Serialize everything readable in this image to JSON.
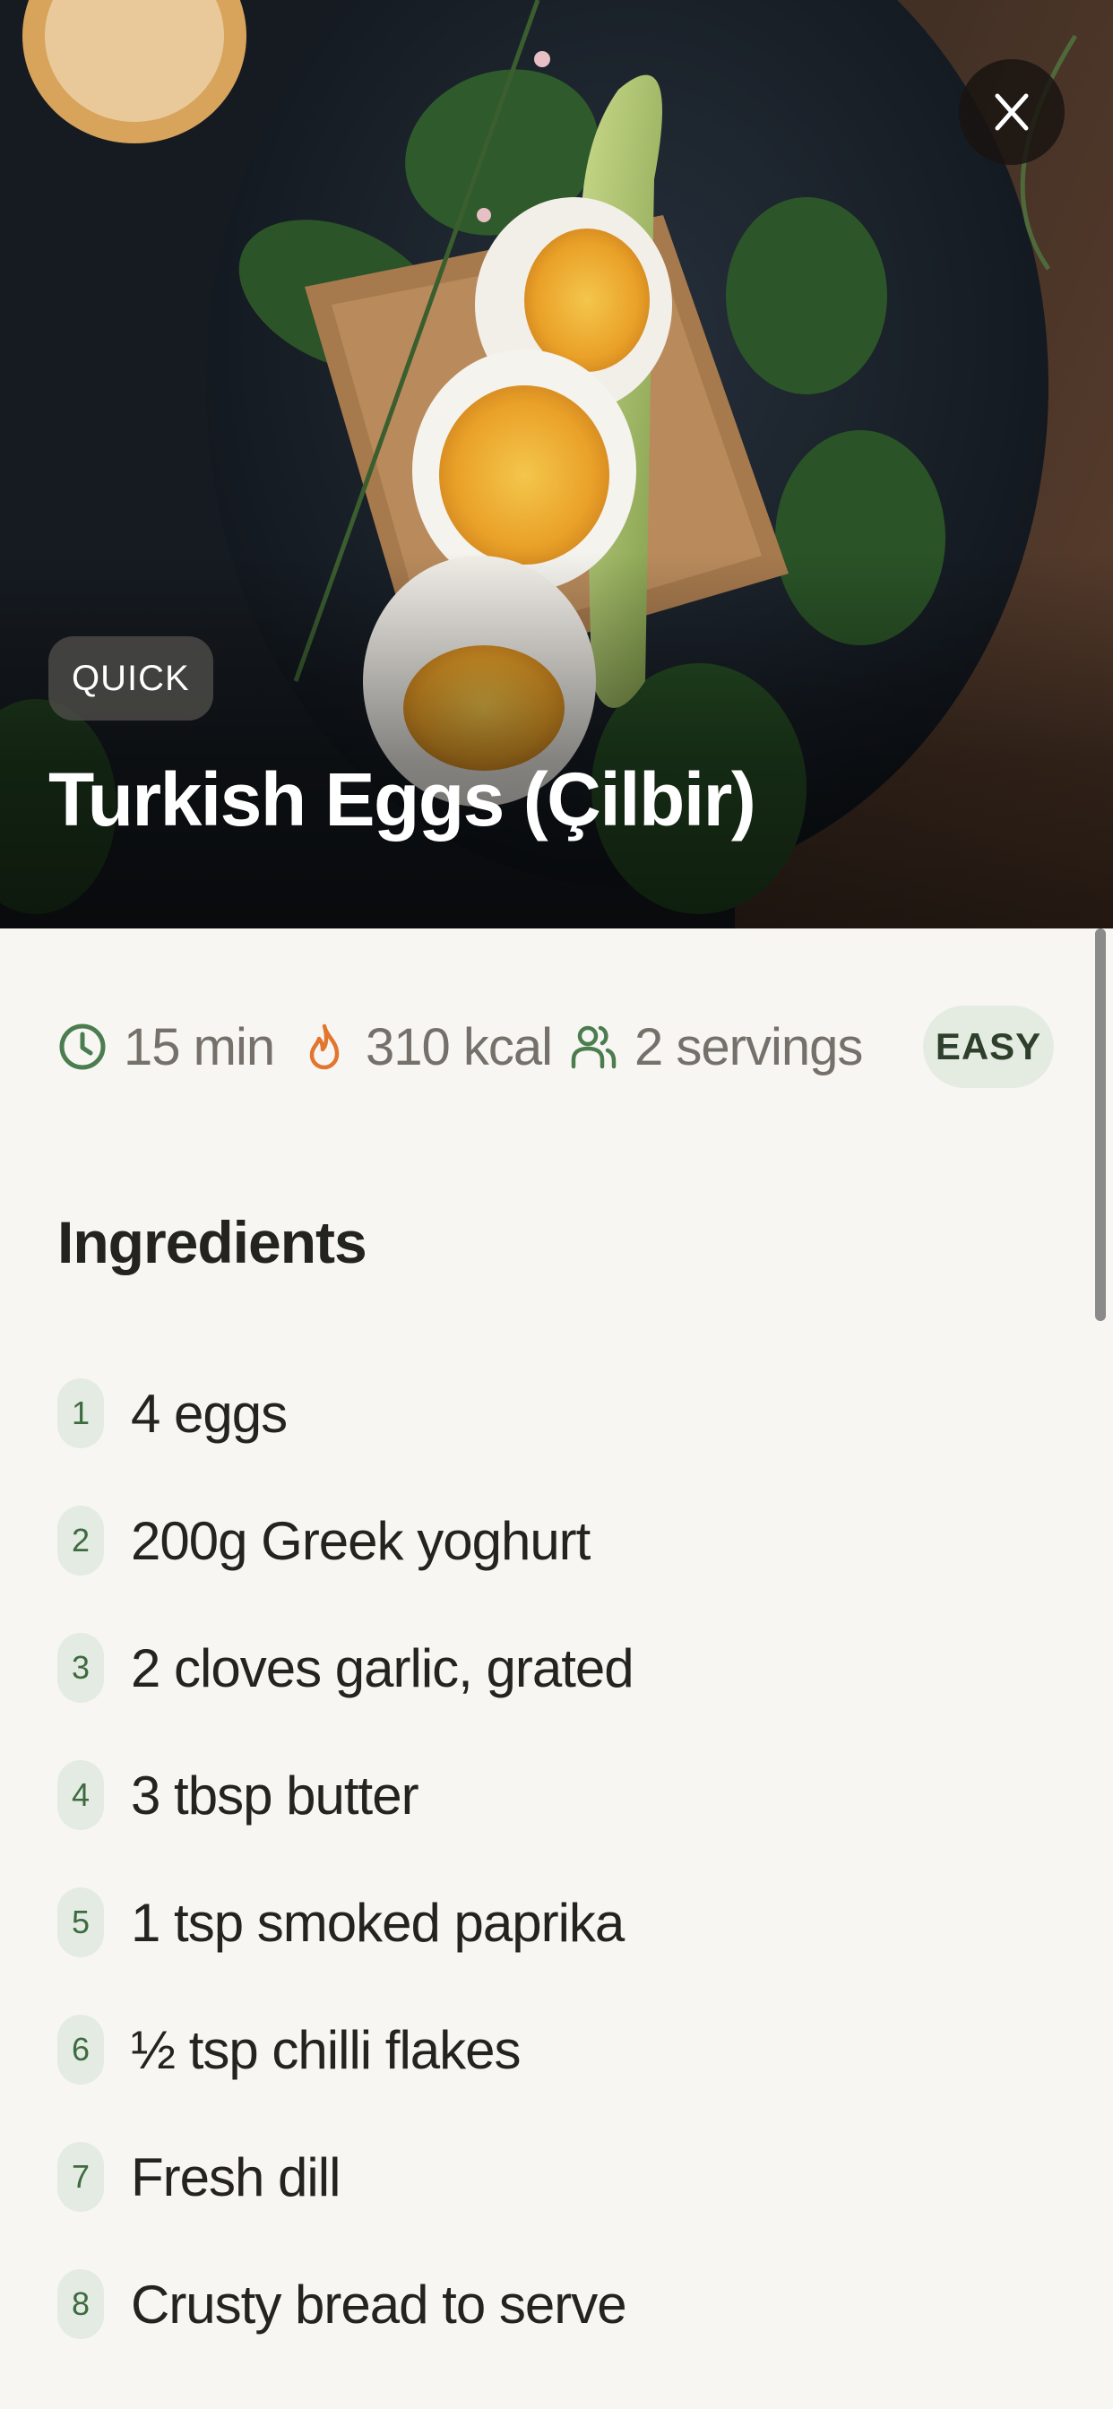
{
  "hero": {
    "tag": "QUICK",
    "title": "Turkish Eggs (Çilbir)"
  },
  "icons": {
    "close": "close-icon",
    "time": "clock-icon",
    "calories": "flame-icon",
    "servings": "people-icon"
  },
  "stats": {
    "time": "15 min",
    "calories": "310 kcal",
    "servings": "2 servings",
    "difficulty": "EASY"
  },
  "ingredients": {
    "heading": "Ingredients",
    "items": [
      {
        "num": "1",
        "text": "4 eggs"
      },
      {
        "num": "2",
        "text": "200g Greek yoghurt"
      },
      {
        "num": "3",
        "text": "2 cloves garlic, grated"
      },
      {
        "num": "4",
        "text": "3 tbsp butter"
      },
      {
        "num": "5",
        "text": "1 tsp smoked paprika"
      },
      {
        "num": "6",
        "text": "½ tsp chilli flakes"
      },
      {
        "num": "7",
        "text": "Fresh dill"
      },
      {
        "num": "8",
        "text": "Crusty bread to serve"
      }
    ]
  },
  "colors": {
    "accent_green": "#3d6b40",
    "flame_orange": "#e2762f",
    "background": "#f7f6f3",
    "badge_bg": "#e4ece2"
  }
}
